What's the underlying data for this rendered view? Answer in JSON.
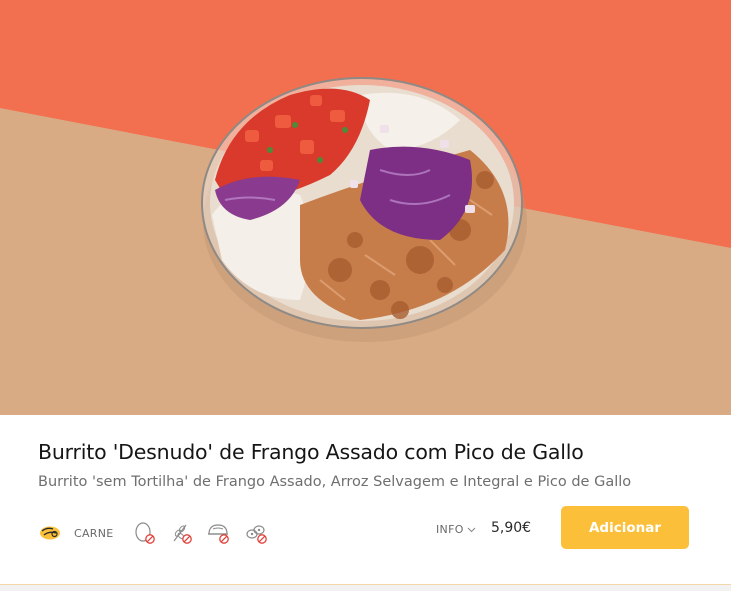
{
  "product": {
    "image_alt": "Burrito bowl",
    "title": "Burrito 'Desnudo' de Frango Assado com Pico de Gallo",
    "subtitle": "Burrito 'sem Tortilha' de Frango Assado, Arroz Selvagem e Integral e Pico de Gallo",
    "category_icon": "meat-icon",
    "category_label": "CARNE",
    "allergen_icons": [
      "no-egg-icon",
      "no-gluten-icon",
      "no-dairy-icon",
      "no-nuts-icon"
    ],
    "info_label": "INFO",
    "price": "5,90€",
    "add_button_label": "Adicionar"
  },
  "colors": {
    "accent": "#fbbf3a",
    "hero_top": "#f2704f",
    "hero_bottom": "#d9ab85",
    "allergen_red": "#e0413a"
  }
}
